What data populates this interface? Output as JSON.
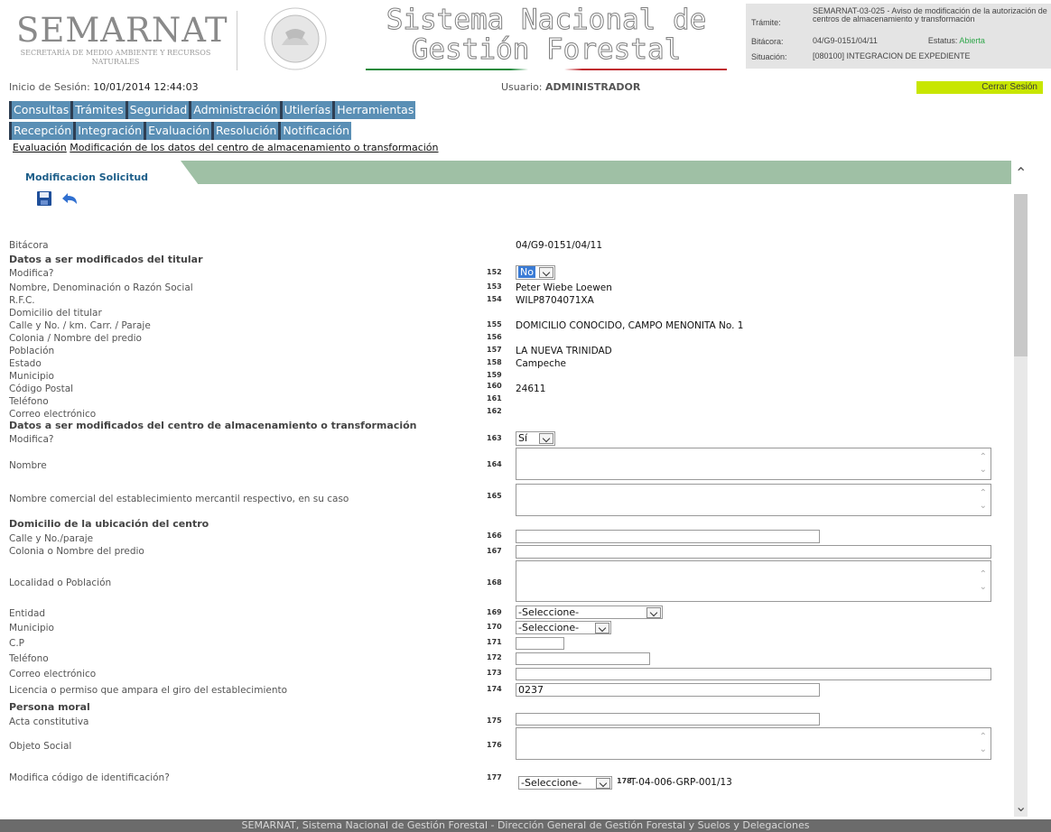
{
  "header": {
    "logo": "SEMARNAT",
    "logo_sub": "SECRETARÍA DE MEDIO AMBIENTE Y RECURSOS NATURALES",
    "title_line1": "Sistema Nacional de",
    "title_line2": "Gestión Forestal",
    "tramite_label": "Trámite:",
    "tramite_value": "SEMARNAT-03-025 - Aviso de modificación de la autorización de centros de almacenamiento y transformación",
    "bitacora_label": "Bitácora:",
    "bitacora_value": "04/G9-0151/04/11",
    "estatus_label": "Estatus:",
    "estatus_value": "Abierta",
    "situacion_label": "Situación:",
    "situacion_value": "[080100] INTEGRACION DE EXPEDIENTE"
  },
  "session": {
    "inicio_label": "Inicio de Sesión:",
    "inicio_value": "10/01/2014 12:44:03",
    "usuario_label": "Usuario:",
    "usuario_value": "ADMINISTRADOR",
    "logout_label": "Cerrar Sesión"
  },
  "menu1": [
    "Consultas",
    "Trámites",
    "Seguridad",
    "Administración",
    "Utilerías",
    "Herramientas"
  ],
  "menu2": [
    "Recepción",
    "Integración",
    "Evaluación",
    "Resolución",
    "Notificación"
  ],
  "breadcrumb": {
    "b1": "Evaluación",
    "b2": "Modificación de los datos del centro de almacenamiento o transformación"
  },
  "tab": {
    "label": "Modificacion Solicitud"
  },
  "form": {
    "bitacora_label": "Bitácora",
    "bitacora_value": "04/G9-0151/04/11",
    "sec_titular": "Datos a ser modificados del titular",
    "modifica_label": "Modifica?",
    "modifica1_value": "No",
    "nombre_label": "Nombre, Denominación o Razón Social",
    "nombre_value": "Peter Wiebe Loewen",
    "rfc_label": "R.F.C.",
    "rfc_value": "WILP8704071XA",
    "domicilio_label": "Domicilio del titular",
    "calle_label": "Calle y No. / km. Carr. / Paraje",
    "calle_value": "DOMICILIO CONOCIDO, CAMPO MENONITA No. 1",
    "colonia_label": "Colonia / Nombre del predio",
    "poblacion_label": "Población",
    "poblacion_value": "LA NUEVA TRINIDAD",
    "estado_label": "Estado",
    "estado_value": "Campeche",
    "municipio_label": "Municipio",
    "cp_label": "Código Postal",
    "cp_value": "24611",
    "telefono_label": "Teléfono",
    "correo_label": "Correo electrónico",
    "sec_centro": "Datos a ser modificados del centro de almacenamiento o transformación",
    "modifica2_value": "Sí",
    "nombre2_label": "Nombre",
    "comercial_label": "Nombre comercial del establecimiento mercantil respectivo, en su caso",
    "sec_domicilio": "Domicilio de la ubicación del centro",
    "calle2_label": "Calle y No./paraje",
    "colonia2_label": "Colonia o Nombre del predio",
    "localidad_label": "Localidad o Población",
    "entidad_label": "Entidad",
    "entidad_value": "-Seleccione-",
    "municipio2_label": "Municipio",
    "municipio2_value": "-Seleccione-",
    "cp2_label": "C.P",
    "telefono2_label": "Teléfono",
    "correo2_label": "Correo electrónico",
    "licencia_label": "Licencia o permiso que ampara el giro del establecimiento",
    "licencia_value": "0237",
    "sec_moral": "Persona moral",
    "acta_label": "Acta constitutiva",
    "objeto_label": "Objeto Social",
    "codigo_label": "Modifica código de identificación?",
    "codigo_sel_value": "-Seleccione-",
    "codigo_value": "T-04-006-GRP-001/13",
    "nums": [
      "152",
      "153",
      "154",
      "155",
      "156",
      "157",
      "158",
      "159",
      "160",
      "161",
      "162",
      "163",
      "164",
      "165",
      "166",
      "167",
      "168",
      "169",
      "170",
      "171",
      "172",
      "173",
      "174",
      "175",
      "176",
      "177",
      "178"
    ]
  },
  "footer": "SEMARNAT, Sistema Nacional de Gestión Forestal - Dirección General de Gestión Forestal y Suelos y Delegaciones"
}
